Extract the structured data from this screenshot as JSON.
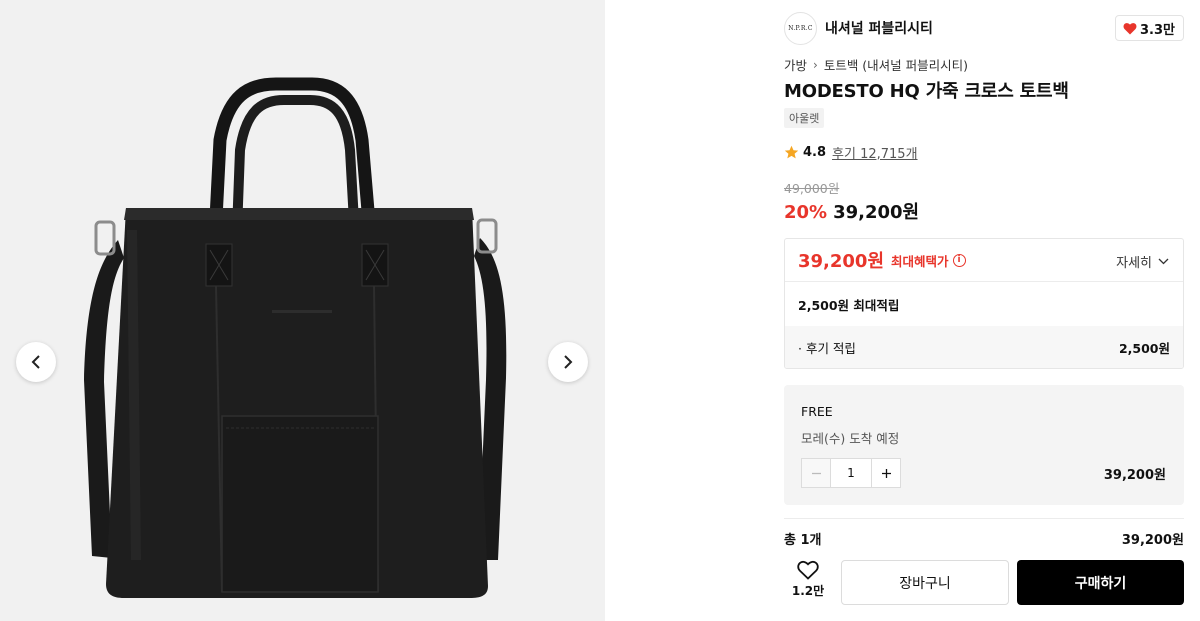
{
  "brand": {
    "logo_text": "N.P.R.C",
    "name": "내셔널 퍼블리시티"
  },
  "likes": {
    "count": "3.3만",
    "icon": "heart-filled-icon",
    "color": "#e8352b"
  },
  "breadcrumb": {
    "category": "가방",
    "subcategory": "토트백 (내셔널 퍼블리시티)"
  },
  "product": {
    "title": "MODESTO HQ 가죽 크로스 토트백",
    "tag": "아울렛",
    "rating": "4.8",
    "reviews": "후기 12,715개",
    "original_price": "49,000원",
    "discount": "20%",
    "sale_price": "39,200원"
  },
  "benefit": {
    "max_price": "39,200원",
    "max_label": "최대혜택가",
    "detail_label": "자세히",
    "points_label": "2,500원 최대적립",
    "review_points_label": "· 후기 적립",
    "review_points_value": "2,500원"
  },
  "option": {
    "free_label": "FREE",
    "delivery": "모레(수) 도착 예정",
    "quantity": "1",
    "price": "39,200원"
  },
  "total": {
    "label": "총 1개",
    "price": "39,200원"
  },
  "actions": {
    "wish_count": "1.2만",
    "cart_label": "장바구니",
    "buy_label": "구매하기"
  },
  "colors": {
    "accent_red": "#e8352b",
    "buy_button": "#000000",
    "star": "#f5a623"
  }
}
